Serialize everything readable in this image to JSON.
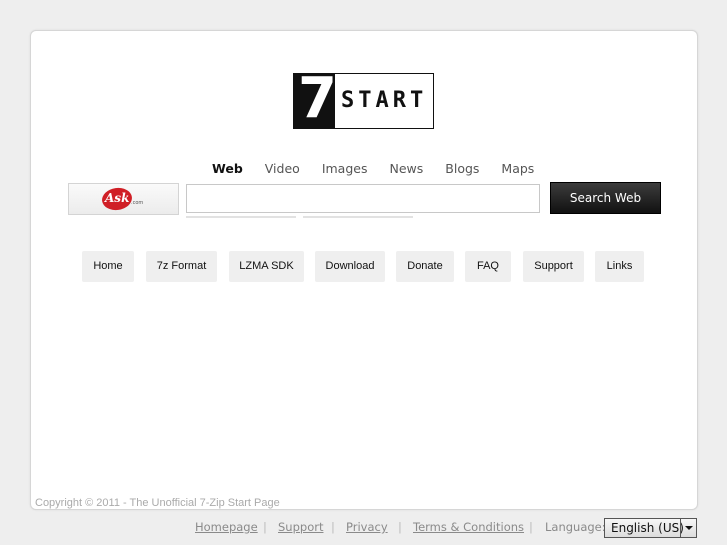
{
  "logo": {
    "seven": "7",
    "start": "START"
  },
  "search": {
    "tabs": [
      {
        "label": "Web",
        "active": true
      },
      {
        "label": "Video",
        "active": false
      },
      {
        "label": "Images",
        "active": false
      },
      {
        "label": "News",
        "active": false
      },
      {
        "label": "Blogs",
        "active": false
      },
      {
        "label": "Maps",
        "active": false
      }
    ],
    "provider_logo_text": "Ask",
    "provider_logo_suffix": ".com",
    "query": "",
    "button_label": "Search Web"
  },
  "nav": [
    {
      "label": "Home"
    },
    {
      "label": "7z Format"
    },
    {
      "label": "LZMA SDK"
    },
    {
      "label": "Download"
    },
    {
      "label": "Donate"
    },
    {
      "label": "FAQ"
    },
    {
      "label": "Support"
    },
    {
      "label": "Links"
    }
  ],
  "copyright": "Copyright © 2011 - The Unofficial 7-Zip Start Page",
  "footer": {
    "links": [
      {
        "label": "Homepage"
      },
      {
        "label": "Support"
      },
      {
        "label": "Privacy"
      },
      {
        "label": "Terms & Conditions"
      }
    ],
    "separator": "|",
    "language_label": "Language:",
    "language_value": "English (US)"
  },
  "colors": {
    "background": "#eeeeee",
    "card": "#ffffff",
    "button_dark": "#111111",
    "ask_red": "#d01f26",
    "footer_text": "#8a8a8a"
  }
}
